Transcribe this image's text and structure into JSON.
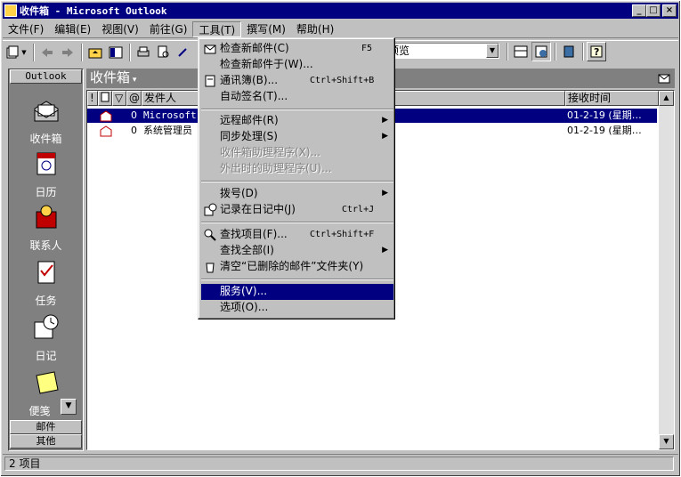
{
  "window": {
    "title": "收件箱 - Microsoft Outlook"
  },
  "menubar": [
    {
      "label": "文件(F)"
    },
    {
      "label": "编辑(E)"
    },
    {
      "label": "视图(V)"
    },
    {
      "label": "前往(G)"
    },
    {
      "label": "工具(T)"
    },
    {
      "label": "撰写(M)"
    },
    {
      "label": "帮助(H)"
    }
  ],
  "toolbar": {
    "view_combo": "预览"
  },
  "outlook_bar": {
    "header": "Outlook",
    "items": [
      {
        "label": "收件箱",
        "icon": "inbox-icon"
      },
      {
        "label": "日历",
        "icon": "calendar-icon"
      },
      {
        "label": "联系人",
        "icon": "contacts-icon"
      },
      {
        "label": "任务",
        "icon": "tasks-icon"
      },
      {
        "label": "日记",
        "icon": "journal-icon"
      },
      {
        "label": "便笺",
        "icon": "notes-icon"
      }
    ],
    "footer_mail": "邮件",
    "footer_other": "其他"
  },
  "folder": {
    "name": "收件箱"
  },
  "columns": {
    "importance": "!",
    "flag": "▽",
    "from": "发件人",
    "received": "接收时间"
  },
  "messages": [
    {
      "from": "Microsoft",
      "received": "01-2-19 (星期…",
      "selected": true
    },
    {
      "from": "系统管理员",
      "received": "01-2-19 (星期…",
      "selected": false
    }
  ],
  "tools_menu": [
    {
      "label": "检查新邮件(C)",
      "shortcut": "F5"
    },
    {
      "label": "检查新邮件于(W)..."
    },
    {
      "label": "通讯簿(B)...",
      "shortcut": "Ctrl+Shift+B"
    },
    {
      "label": "自动签名(T)..."
    },
    {
      "label": "远程邮件(R)"
    },
    {
      "label": "同步处理(S)"
    },
    {
      "label": "收件箱助理程序(X)..."
    },
    {
      "label": "外出时的助理程序(U)..."
    },
    {
      "label": "拨号(D)"
    },
    {
      "label": "记录在日记中(J)",
      "shortcut": "Ctrl+J"
    },
    {
      "label": "查找项目(F)...",
      "shortcut": "Ctrl+Shift+F"
    },
    {
      "label": "查找全部(I)"
    },
    {
      "label": "清空“已删除的邮件”文件夹(Y)"
    },
    {
      "label": "服务(V)..."
    },
    {
      "label": "选项(O)..."
    }
  ],
  "status": {
    "text": "2 项目"
  }
}
